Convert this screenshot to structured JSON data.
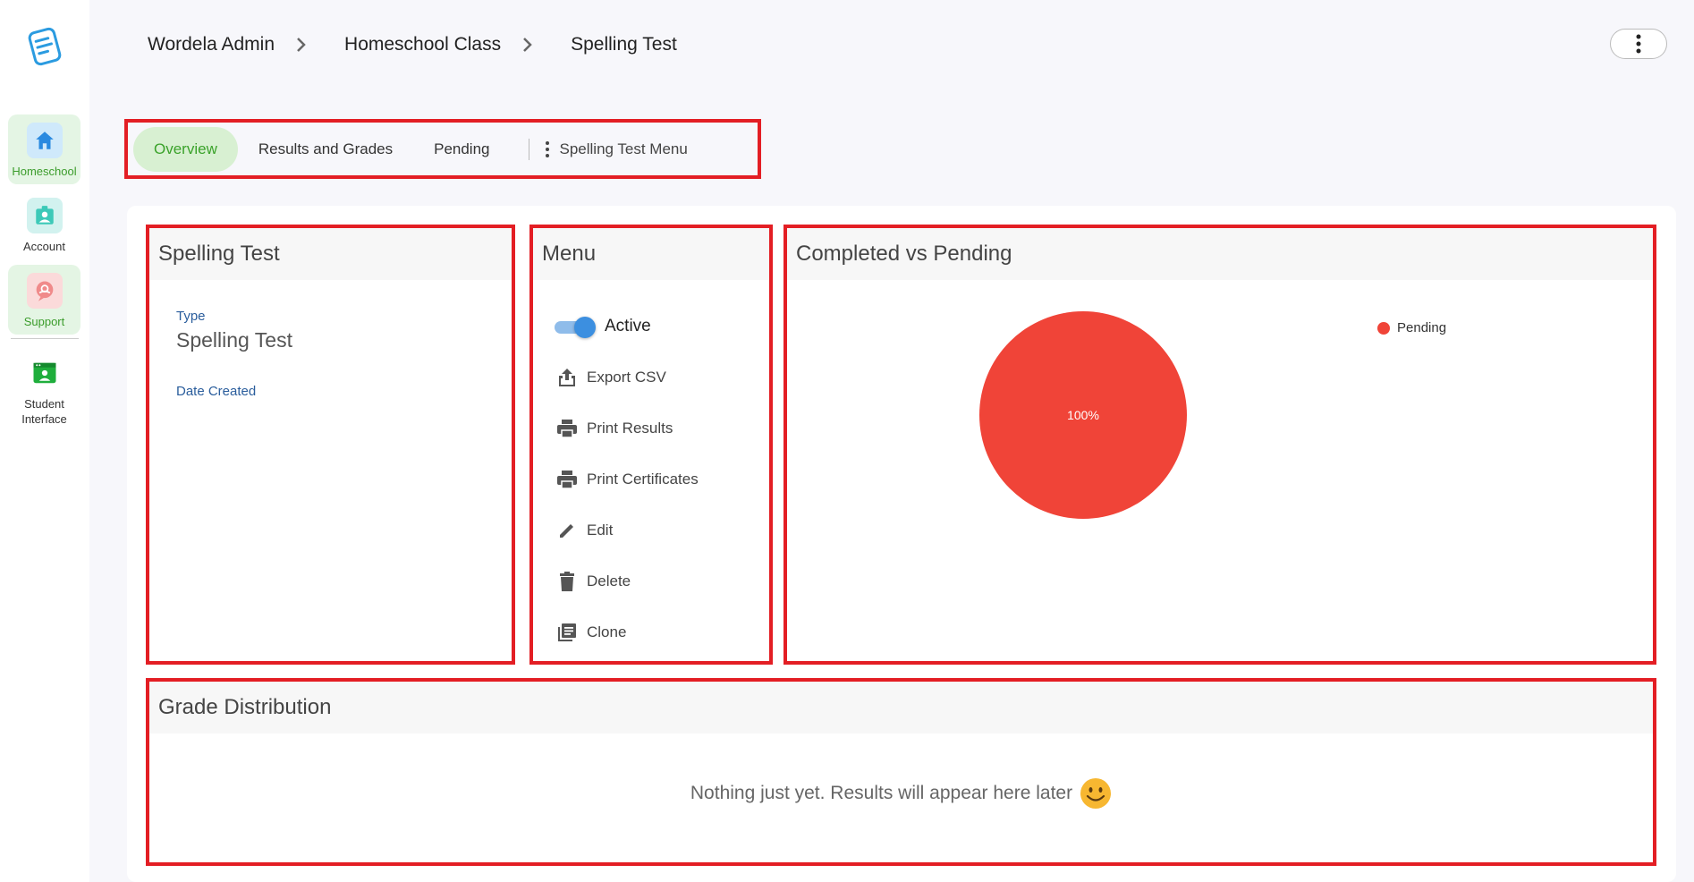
{
  "sidebar": {
    "items": [
      {
        "label": "Homeschool",
        "icon": "home-icon"
      },
      {
        "label": "Account",
        "icon": "account-badge-icon"
      },
      {
        "label": "Support",
        "icon": "support-chat-icon"
      },
      {
        "label": "Student Interface",
        "icon": "student-interface-icon"
      }
    ]
  },
  "breadcrumb": {
    "items": [
      "Wordela Admin",
      "Homeschool Class",
      "Spelling Test"
    ]
  },
  "tabs": {
    "overview": "Overview",
    "results": "Results and Grades",
    "pending": "Pending",
    "menu": "Spelling Test Menu"
  },
  "info_card": {
    "title": "Spelling Test",
    "type_label": "Type",
    "type_value": "Spelling Test",
    "date_label": "Date Created"
  },
  "menu_card": {
    "title": "Menu",
    "active_label": "Active",
    "active_on": true,
    "items": [
      "Export CSV",
      "Print Results",
      "Print Certificates",
      "Edit",
      "Delete",
      "Clone"
    ]
  },
  "chart_card": {
    "title": "Completed vs Pending"
  },
  "chart_data": {
    "type": "pie",
    "series": [
      {
        "name": "Pending",
        "value": 100,
        "color": "#f04438",
        "label": "100%"
      }
    ],
    "legend": "top-right"
  },
  "grade_card": {
    "title": "Grade Distribution",
    "empty_message": "Nothing just yet. Results will appear here later"
  },
  "colors": {
    "accent_green": "#3aa22a",
    "highlight_red": "#e31e24",
    "pie_pending": "#f04438"
  }
}
